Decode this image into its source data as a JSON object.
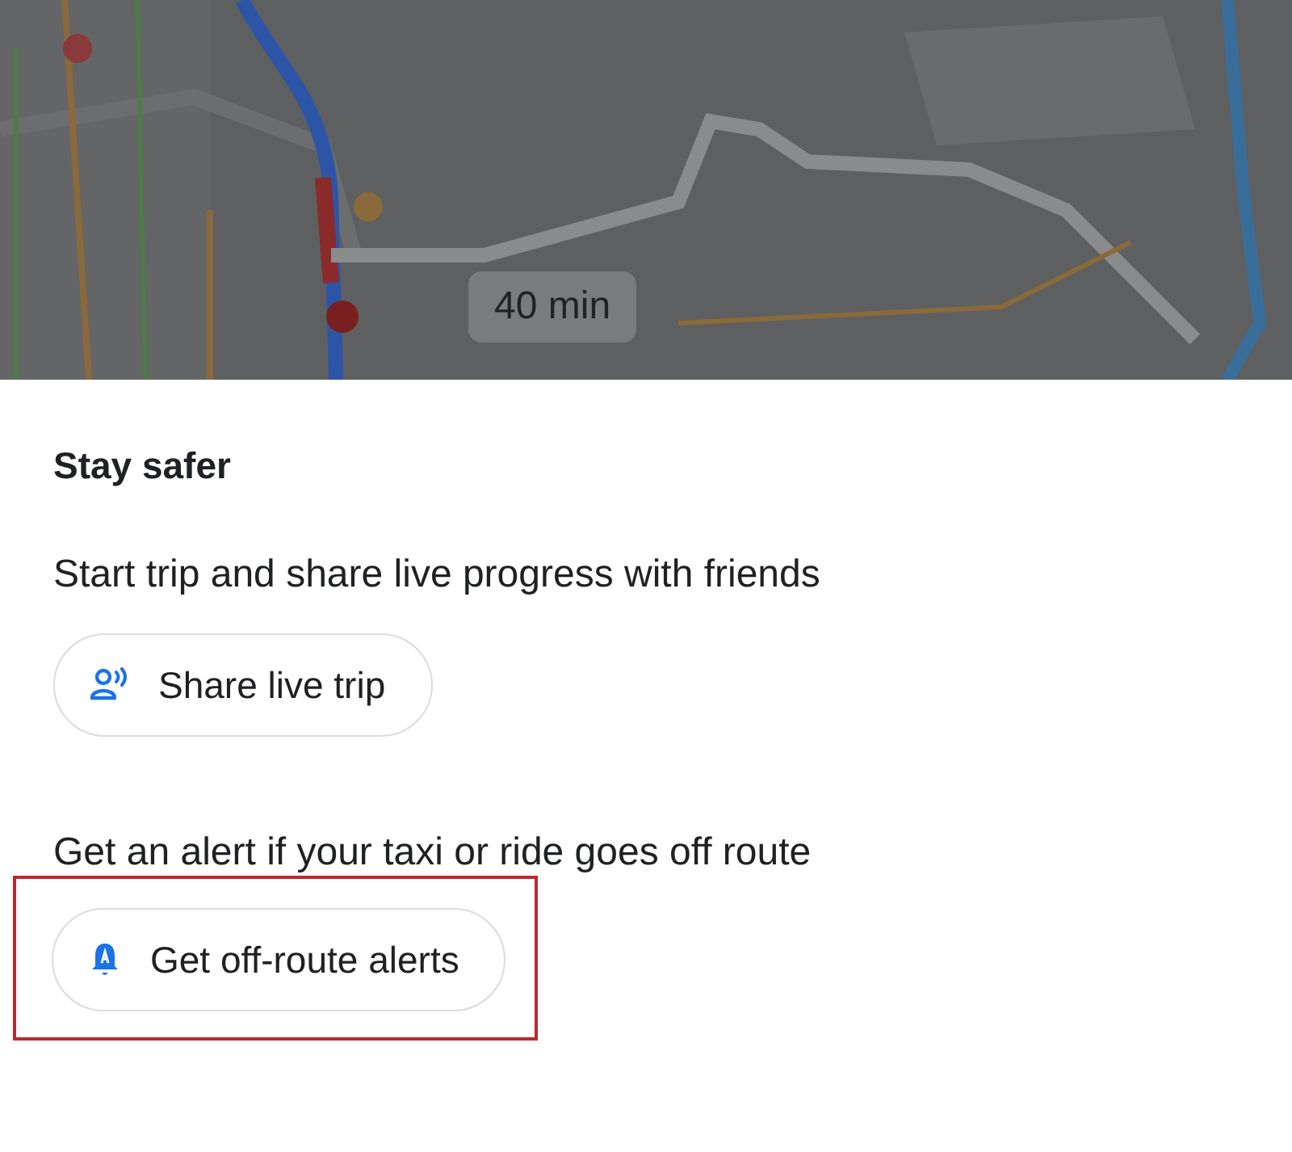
{
  "map": {
    "eta_label": "40 min"
  },
  "panel": {
    "title": "Stay safer",
    "sections": [
      {
        "description": "Start trip and share live progress with friends",
        "button": {
          "label": "Share live trip",
          "highlighted": false
        }
      },
      {
        "description": "Get an alert if your taxi or ride goes off route",
        "button": {
          "label": "Get off-route alerts",
          "highlighted": true
        }
      }
    ]
  }
}
